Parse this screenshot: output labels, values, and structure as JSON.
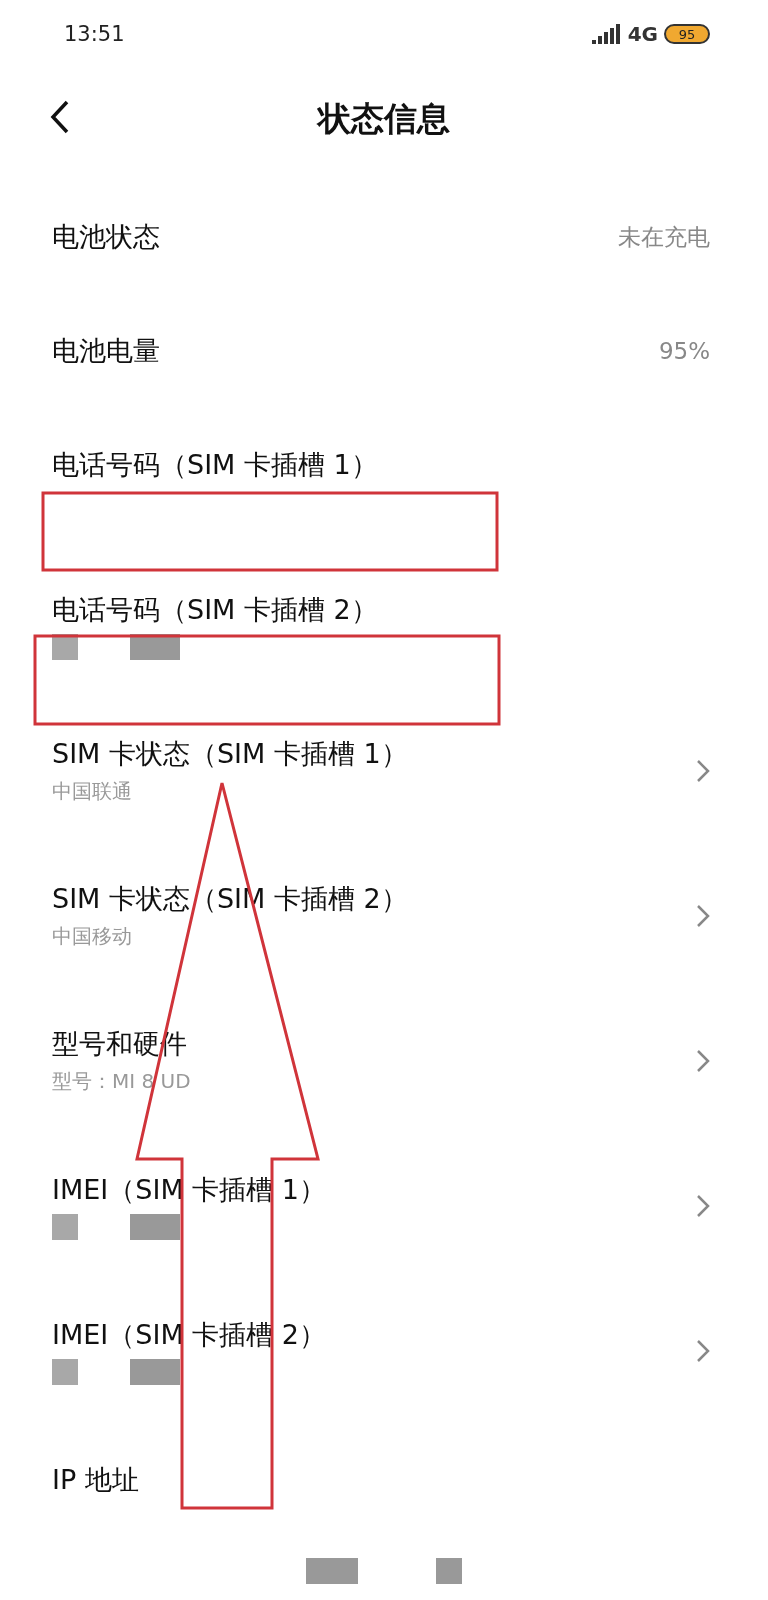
{
  "status_bar": {
    "time": "13:51",
    "network": "4G",
    "battery": "95"
  },
  "header": {
    "title": "状态信息"
  },
  "items": [
    {
      "kind": "value",
      "title": "电池状态",
      "value": "未在充电"
    },
    {
      "kind": "value",
      "title": "电池电量",
      "value": "95%"
    },
    {
      "kind": "plain",
      "title": "电话号码（SIM 卡插槽 1）",
      "redacted": false
    },
    {
      "kind": "plain",
      "title": "电话号码（SIM 卡插槽 2）",
      "redacted": true
    },
    {
      "kind": "link",
      "title": "SIM 卡状态（SIM 卡插槽 1）",
      "subtitle": "中国联通",
      "redacted": false
    },
    {
      "kind": "link",
      "title": "SIM 卡状态（SIM 卡插槽 2）",
      "subtitle": "中国移动",
      "redacted": false
    },
    {
      "kind": "link",
      "title": "型号和硬件",
      "subtitle": "型号：MI 8 UD",
      "redacted": false
    },
    {
      "kind": "link",
      "title": "IMEI（SIM 卡插槽 1）",
      "redacted": true
    },
    {
      "kind": "link",
      "title": "IMEI（SIM 卡插槽 2）",
      "redacted": true
    },
    {
      "kind": "plain",
      "title": "IP 地址",
      "redacted": false
    }
  ]
}
